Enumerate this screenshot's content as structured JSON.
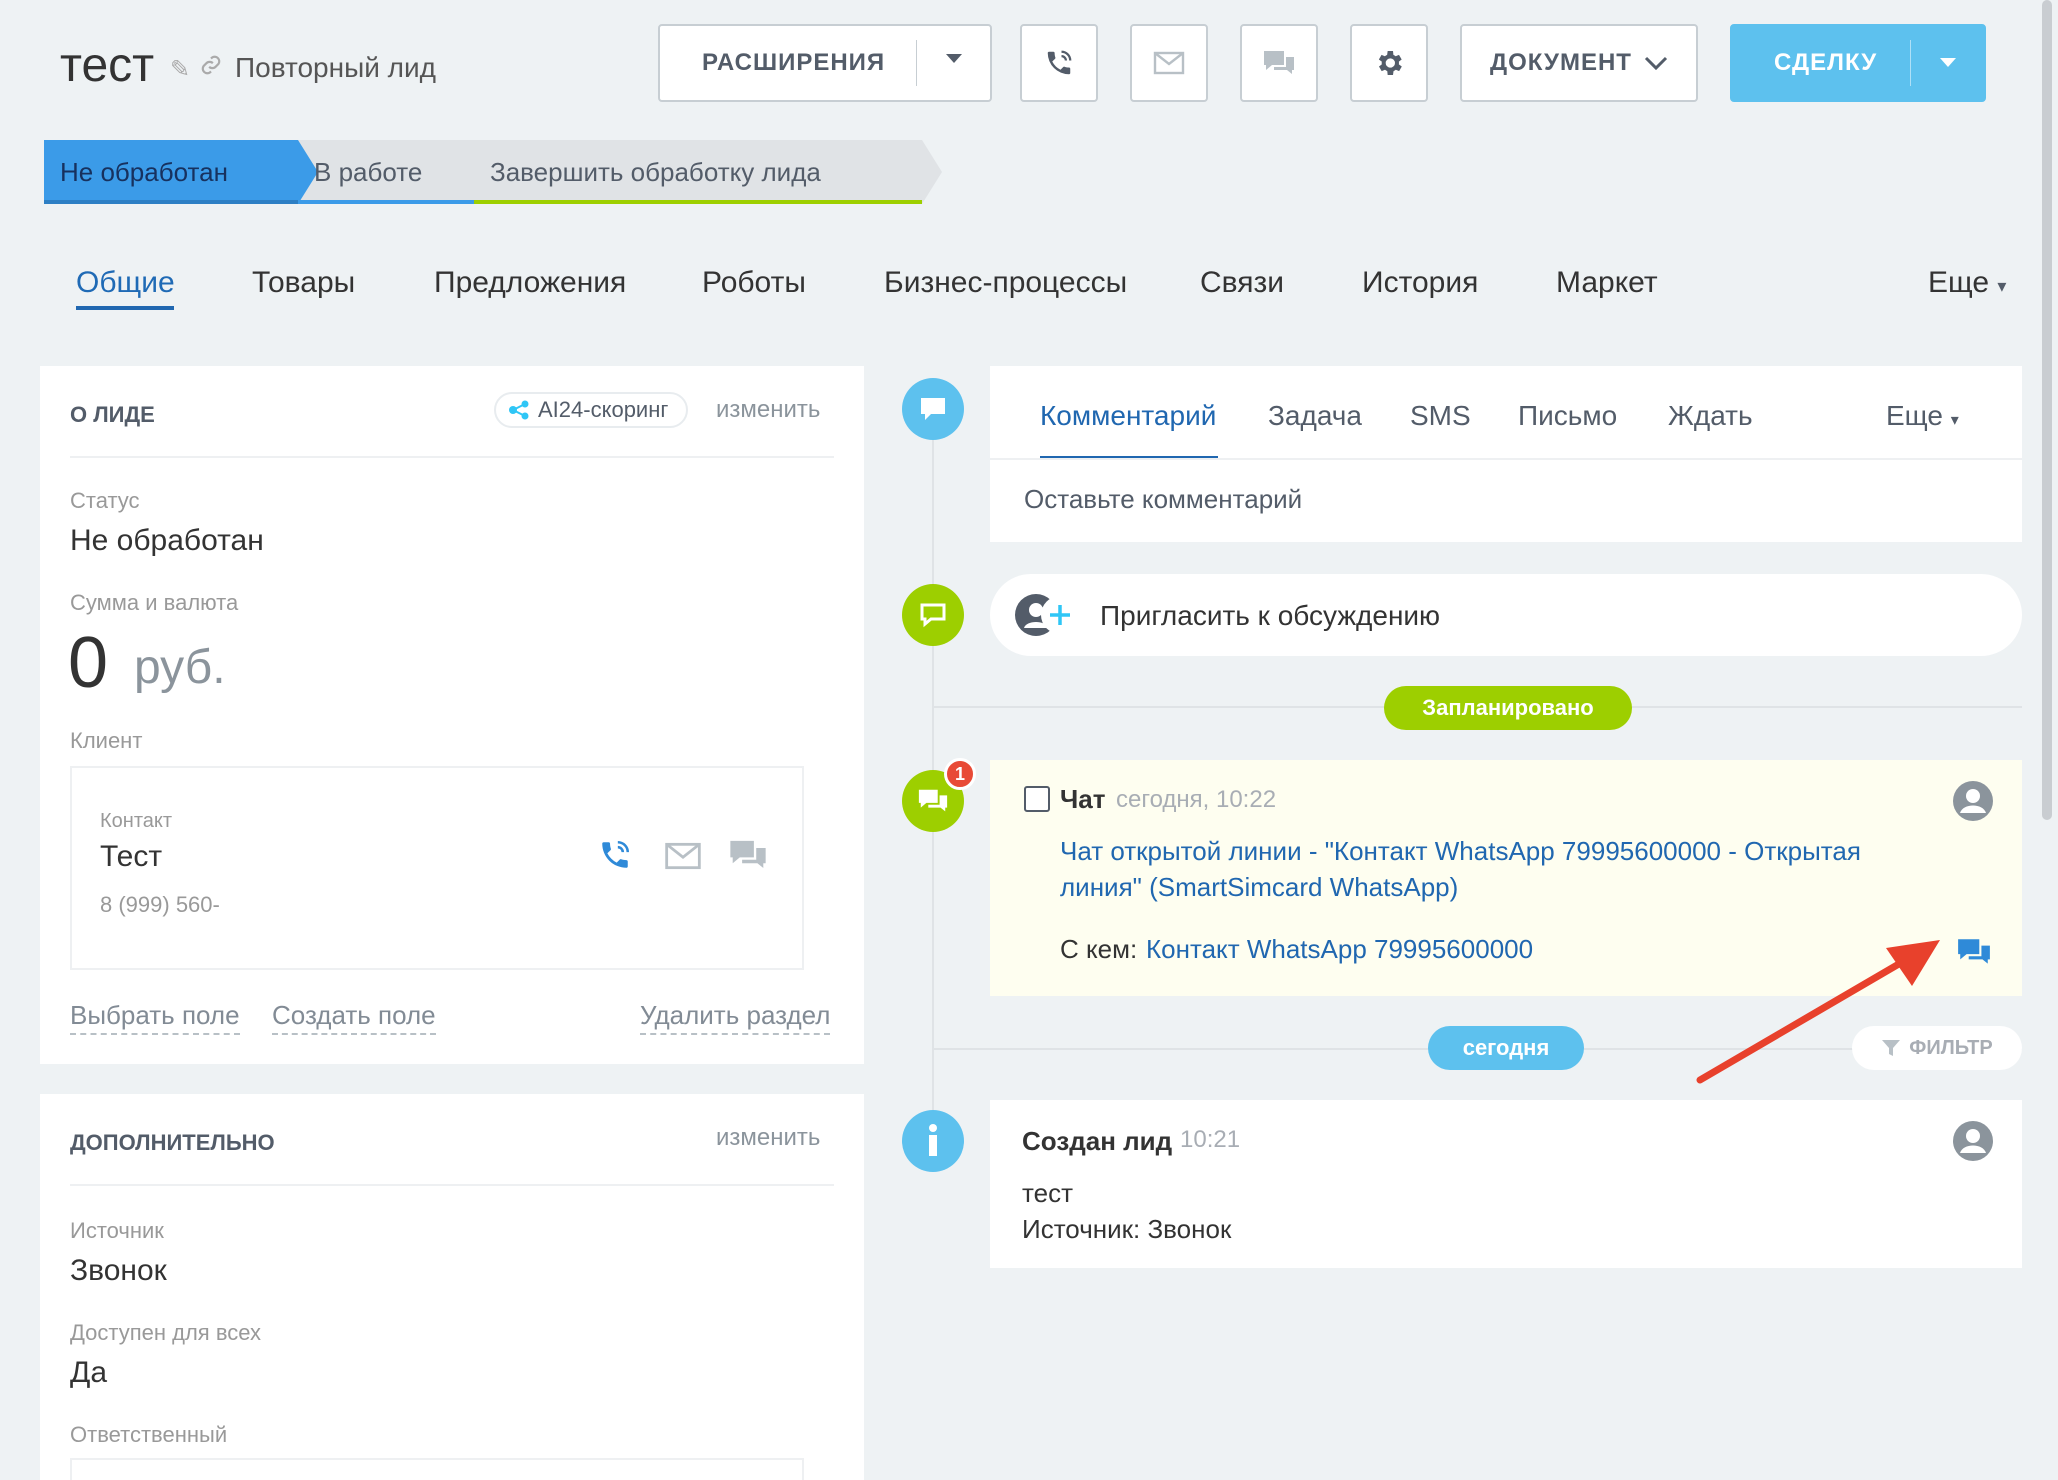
{
  "header": {
    "title": "тест",
    "subtitle": "Повторный лид",
    "extensions_label": "РАСШИРЕНИЯ",
    "document_label": "ДОКУМЕНТ",
    "deal_label": "СДЕЛКУ"
  },
  "stages": [
    {
      "label": "Не обработан",
      "color": "#3b9be8"
    },
    {
      "label": "В работе",
      "color": "#d8dbde"
    },
    {
      "label": "Завершить обработку лида",
      "color": "#d8dbde"
    }
  ],
  "tabs": [
    "Общие",
    "Товары",
    "Предложения",
    "Роботы",
    "Бизнес-процессы",
    "Связи",
    "История",
    "Маркет",
    "Еще"
  ],
  "about": {
    "heading": "О ЛИДЕ",
    "scoring_label": "AI24-скоринг",
    "edit_label": "изменить",
    "status_label": "Статус",
    "status_value": "Не обработан",
    "sum_label": "Сумма и валюта",
    "sum_value": "0",
    "currency": "руб.",
    "client_label": "Клиент",
    "contact_label": "Контакт",
    "contact_name": "Тест",
    "contact_phone": "8 (999) 560-",
    "choose_field": "Выбрать поле",
    "create_field": "Создать поле",
    "delete_section": "Удалить раздел"
  },
  "extra": {
    "heading": "ДОПОЛНИТЕЛЬНО",
    "edit_label": "изменить",
    "source_label": "Источник",
    "source_value": "Звонок",
    "available_label": "Доступен для всех",
    "available_value": "Да",
    "responsible_label": "Ответственный"
  },
  "composer": {
    "tabs": [
      "Комментарий",
      "Задача",
      "SMS",
      "Письмо",
      "Ждать",
      "Еще"
    ],
    "placeholder": "Оставьте комментарий"
  },
  "invite": {
    "label": "Пригласить к обсуждению"
  },
  "planned_label": "Запланировано",
  "chat": {
    "badge": "1",
    "title": "Чат",
    "time": "сегодня, 10:22",
    "link_line1": "Чат открытой линии - \"Контакт WhatsApp 79995600000 - Открытая",
    "link_line2": "линия\" (SmartSimcard WhatsApp)",
    "with_label": "С кем:",
    "with_value": "Контакт WhatsApp 79995600000"
  },
  "today_label": "сегодня",
  "filter_label": "ФИЛЬТР",
  "created": {
    "title": "Создан лид",
    "time": "10:21",
    "line1": "тест",
    "line2": "Источник: Звонок"
  },
  "colors": {
    "blue": "#5dc1ee",
    "green": "#9dcf00",
    "link": "#2067b0",
    "arrow": "#e8412c"
  }
}
